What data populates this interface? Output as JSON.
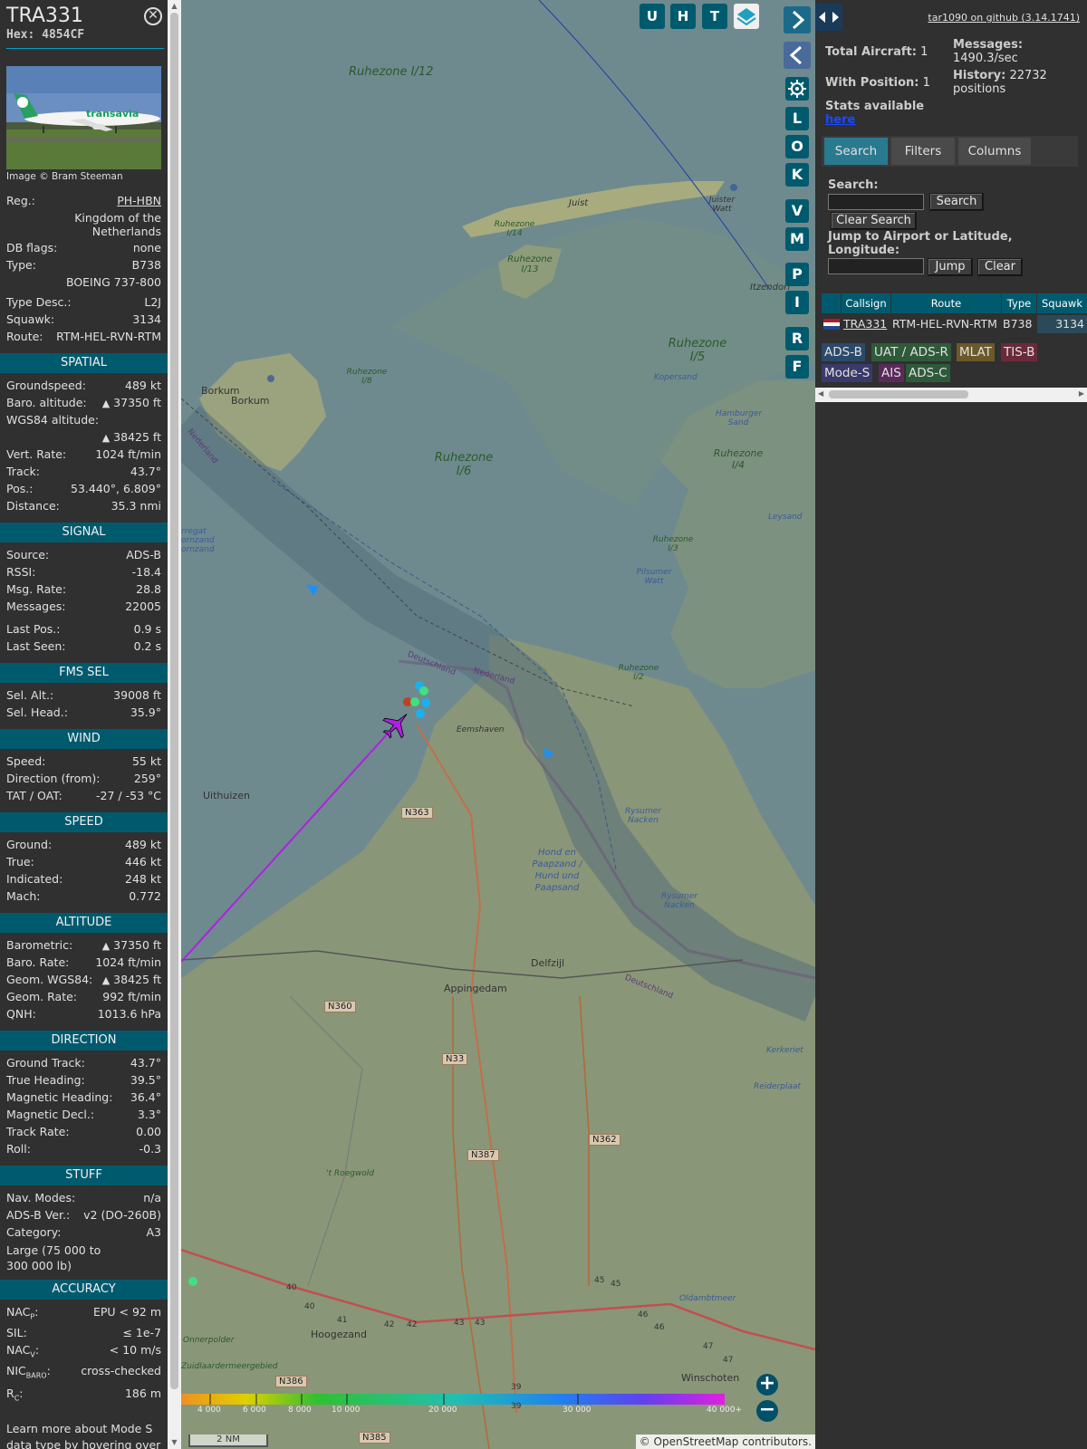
{
  "aircraft": {
    "callsign": "TRA331",
    "hex": "Hex: 4854CF",
    "photo_credit": "Image © Bram Steeman",
    "photo_livery_text": "transavia",
    "reg_label": "Reg.:",
    "reg": "PH-HBN",
    "country": "Kingdom of the Netherlands",
    "rows_basic": [
      {
        "k": "DB flags:",
        "v": "none"
      },
      {
        "k": "Type:",
        "v": "B738"
      }
    ],
    "type_full": "BOEING 737-800",
    "rows_basic2": [
      {
        "k": "Type Desc.:",
        "v": "L2J"
      },
      {
        "k": "Squawk:",
        "v": "3134"
      },
      {
        "k": "Route:",
        "v": "RTM-HEL-RVN-RTM"
      }
    ]
  },
  "spatial": {
    "title": "SPATIAL",
    "groundspeed": {
      "k": "Groundspeed:",
      "v": "489 kt"
    },
    "baro_alt": {
      "k": "Baro. altitude:",
      "tri": "▲",
      "v": "37350 ft"
    },
    "wgs_label": "WGS84 altitude:",
    "wgs_value": "38425 ft",
    "tri": "▲",
    "vert_rate": {
      "k": "Vert. Rate:",
      "v": "1024 ft/min"
    },
    "track": {
      "k": "Track:",
      "v": "43.7°"
    },
    "pos": {
      "k": "Pos.:",
      "v": "53.440°, 6.809°"
    },
    "distance": {
      "k": "Distance:",
      "v": "35.3 nmi"
    }
  },
  "signal": {
    "title": "SIGNAL",
    "rows": [
      {
        "k": "Source:",
        "v": "ADS-B"
      },
      {
        "k": "RSSI:",
        "v": "-18.4"
      },
      {
        "k": "Msg. Rate:",
        "v": "28.8"
      },
      {
        "k": "Messages:",
        "v": "22005"
      },
      {
        "k": "Last Pos.:",
        "v": "0.9 s"
      },
      {
        "k": "Last Seen:",
        "v": "0.2 s"
      }
    ]
  },
  "fms": {
    "title": "FMS SEL",
    "rows": [
      {
        "k": "Sel. Alt.:",
        "v": "39008 ft"
      },
      {
        "k": "Sel. Head.:",
        "v": "35.9°"
      }
    ]
  },
  "wind": {
    "title": "WIND",
    "rows": [
      {
        "k": "Speed:",
        "v": "55 kt"
      },
      {
        "k": "Direction (from):",
        "v": "259°"
      },
      {
        "k": "TAT / OAT:",
        "v": "-27 / -53 °C"
      }
    ]
  },
  "speed": {
    "title": "SPEED",
    "rows": [
      {
        "k": "Ground:",
        "v": "489 kt"
      },
      {
        "k": "True:",
        "v": "446 kt"
      },
      {
        "k": "Indicated:",
        "v": "248 kt"
      },
      {
        "k": "Mach:",
        "v": "0.772"
      }
    ]
  },
  "altitude": {
    "title": "ALTITUDE",
    "rows": [
      {
        "k": "Barometric:",
        "tri": "▲",
        "v": "37350 ft"
      },
      {
        "k": "Baro. Rate:",
        "v": "1024 ft/min"
      },
      {
        "k": "Geom. WGS84:",
        "tri": "▲",
        "v": "38425 ft"
      },
      {
        "k": "Geom. Rate:",
        "v": "992 ft/min"
      },
      {
        "k": "QNH:",
        "v": "1013.6 hPa"
      }
    ]
  },
  "direction": {
    "title": "DIRECTION",
    "rows": [
      {
        "k": "Ground Track:",
        "v": "43.7°"
      },
      {
        "k": "True Heading:",
        "v": "39.5°"
      },
      {
        "k": "Magnetic Heading:",
        "v": "36.4°"
      },
      {
        "k": "Magnetic Decl.:",
        "v": "3.3°"
      },
      {
        "k": "Track Rate:",
        "v": "0.00"
      },
      {
        "k": "Roll:",
        "v": "-0.3"
      }
    ]
  },
  "stuff": {
    "title": "STUFF",
    "rows": [
      {
        "k": "Nav. Modes:",
        "v": "n/a"
      },
      {
        "k": "ADS-B Ver.:",
        "v": "v2 (DO-260B)"
      },
      {
        "k": "Category:",
        "v": "A3"
      }
    ],
    "category_desc": "Large (75 000 to 300 000 lb)"
  },
  "accuracy": {
    "title": "ACCURACY",
    "nacp_k": "NAC",
    "nacp_sub": "P",
    "nacp_v": "EPU < 92 m",
    "sil_k": "SIL:",
    "sil_v": "≤ 1e-7",
    "nacv_k": "NAC",
    "nacv_sub": "V",
    "nacv_v": "< 10 m/s",
    "nicbaro_k": "NIC",
    "nicbaro_sub": "BARO",
    "nicbaro_v": "cross-checked",
    "rc_k": "R",
    "rc_sub": "C",
    "rc_v": "186 m",
    "colon": ":"
  },
  "learn_more": "Learn more about Mode S data type by hovering over",
  "map": {
    "top_buttons": [
      "U",
      "H",
      "T"
    ],
    "side_buttons": [
      "L",
      "O",
      "K",
      "V",
      "M",
      "P",
      "I",
      "R",
      "F"
    ],
    "zoom_in": "+",
    "zoom_out": "−",
    "scale": "2 NM",
    "attribution": "© OpenStreetMap contributors.",
    "alt_ticks": [
      "4 000",
      "6 000",
      "8 000",
      "10 000",
      "20 000",
      "30 000",
      "40 000+"
    ],
    "labels": {
      "ruhezone_i12": "Ruhezone I/12",
      "ruhezone_i6": "Ruhezone I/6",
      "ruhezone_i5": "Ruhezone I/5",
      "ruhezone_i4": "Ruhezone I/4",
      "ruhezone_i3": "Ruhezone I/3",
      "ruhezone_i2": "Ruhezone I/2",
      "ruhezone_i8": "Ruhezone I/8",
      "ruhezone_i13": "Ruhezone I/13",
      "ruhezone_i14": "Ruhezone I/14",
      "borkum": "Borkum",
      "borkum2": "Borkum",
      "juist": "Juist",
      "juister_watt": "Juister Watt",
      "itzendorf": "Itzendorf",
      "kopersand": "Kopersand",
      "hamburger_sand": "Hamburger Sand",
      "leysand": "Leysand",
      "pilsumer_watt": "Pilsumer Watt",
      "rysumer_nacken": "Rysumer Nacken",
      "rysumer_nacken2": "Rysumer Nacken",
      "hond": "Hond en Paapzand / Hund und Paapsand",
      "deutschland": "Deutschland",
      "nederland": "Nederland",
      "deutschland2": "Deutschland",
      "nederland2": "Nederland",
      "eemshaven": "Eemshaven",
      "uithuizen": "Uithuizen",
      "delfzijl": "Delfzijl",
      "appingedam": "Appingedam",
      "roegwold": "'t Roegwold",
      "oldambtmeer": "Oldambtmeer",
      "hoogezand": "Hoogezand",
      "winschoten": "Winschoten",
      "onnerpolder": "Onnerpolder",
      "zuidlaardermeer": "Zuidlaardermeergebied",
      "kerkeriet": "Kerkeriet",
      "reiderplaat": "Reiderplaat",
      "fornzand": "rregat ornzand ornzand"
    },
    "roads": [
      "N363",
      "N360",
      "N33",
      "N387",
      "N362",
      "N386",
      "N385"
    ],
    "km_markers": [
      "40",
      "40",
      "41",
      "42",
      "42",
      "43",
      "43",
      "45",
      "45",
      "46",
      "46",
      "47",
      "47",
      "39",
      "39"
    ]
  },
  "right": {
    "github": "tar1090 on github (3.14.1741)",
    "total_label": "Total Aircraft:",
    "total_value": "1",
    "withpos_label": "With Position:",
    "withpos_value": "1",
    "messages_label": "Messages:",
    "messages_value": "1490.3/sec",
    "history_label": "History:",
    "history_value": "22732 positions",
    "stats_label": "Stats available",
    "stats_link": "here",
    "tabs": [
      "Search",
      "Filters",
      "Columns"
    ],
    "search_label": "Search:",
    "search_button": "Search",
    "clear_search": "Clear Search",
    "jump_label": "Jump to Airport or Latitude, Longitude:",
    "jump_button": "Jump",
    "clear_button": "Clear",
    "table_headers": [
      "Callsign",
      "Route",
      "Type",
      "Squawk"
    ],
    "table_row": {
      "callsign": "TRA331",
      "route": "RTM-HEL-RVN-RTM",
      "type": "B738",
      "squawk": "3134"
    },
    "sources": [
      {
        "label": "ADS-B",
        "bg": "#2a4a6a"
      },
      {
        "label": "UAT / ADS-R",
        "bg": "#2f5a3a"
      },
      {
        "label": "MLAT",
        "bg": "#6a5a2a"
      },
      {
        "label": "TIS-B",
        "bg": "#6a2a3a"
      },
      {
        "label": "Mode-S",
        "bg": "#3a3a6a"
      },
      {
        "label": "AIS",
        "bg": "#5a2a5a"
      },
      {
        "label": "ADS-C",
        "bg": "#2f5a3a"
      }
    ]
  },
  "colors": {
    "accent": "#005a6e",
    "track_line": "#b020e0",
    "panel_bg": "#303030"
  }
}
